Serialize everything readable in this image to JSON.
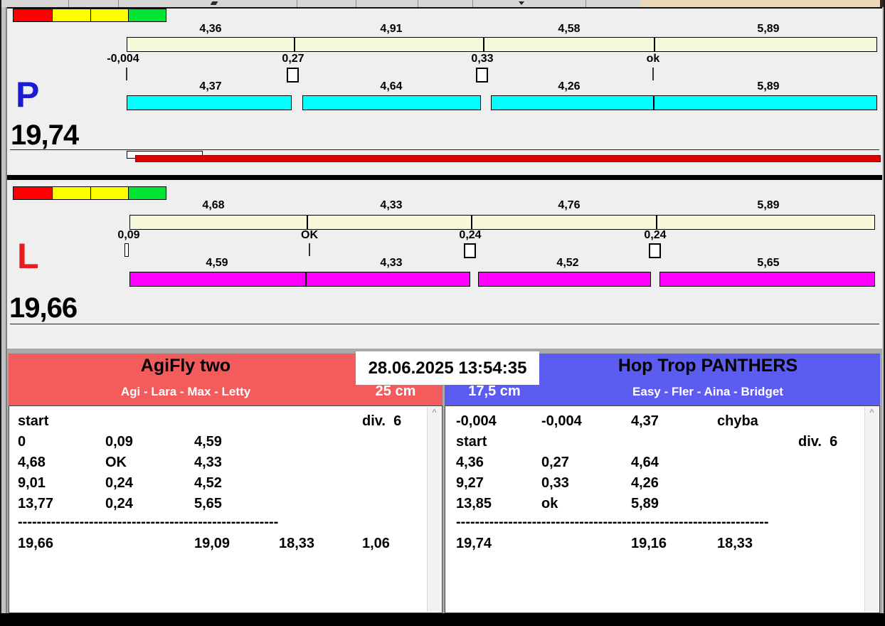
{
  "colors": {
    "strip_cells": [
      "#ff0000",
      "#ffff00",
      "#ffff00",
      "#00e432"
    ],
    "upper_bar": "#f8f8da",
    "lane_p_bar": "#00ffff",
    "lane_l_bar": "#ff00ff",
    "lane_p_letter": "#1b1bd6",
    "lane_l_letter": "#e81c1c",
    "progress_red": "#dd0202",
    "team_left_bg": "#f25c5c",
    "team_right_bg": "#5c5cf0",
    "panel_bg": "#efefef",
    "band_bg": "#a9a9a9"
  },
  "icons": {
    "scroll_up": "^"
  },
  "lane_p": {
    "letter": "P",
    "total": "19,74",
    "upper_segments": [
      "4,36",
      "4,91",
      "4,58",
      "5,89"
    ],
    "markers": [
      "-0,004",
      "0,27",
      "0,33",
      "ok"
    ],
    "lower_segments": [
      "4,37",
      "4,64",
      "4,26",
      "5,89"
    ]
  },
  "lane_l": {
    "letter": "L",
    "total": "19,66",
    "upper_segments": [
      "4,68",
      "4,33",
      "4,76",
      "5,89"
    ],
    "markers": [
      "0,09",
      "OK",
      "0,24",
      "0,24"
    ],
    "lower_segments": [
      "4,59",
      "4,33",
      "4,52",
      "5,65"
    ]
  },
  "scoreboard": {
    "datetime": "28.06.2025 13:54:35",
    "left": {
      "team": "AgiFly two",
      "members": "Agi - Lara - Max - Letty",
      "jump_height": "25 cm",
      "div_label": "div.  6",
      "rows": [
        {
          "c1": "start"
        },
        {
          "c1": "0",
          "c2": "0,09",
          "c3": "4,59"
        },
        {
          "c1": "4,68",
          "c2": "OK",
          "c3": "4,33"
        },
        {
          "c1": "9,01",
          "c2": "0,24",
          "c3": "4,52"
        },
        {
          "c1": "13,77",
          "c2": "0,24",
          "c3": "5,65"
        }
      ],
      "separator": "-------------------------------------------------------",
      "totals": {
        "t1": "19,66",
        "t2": "19,09",
        "t3": "18,33",
        "t4": "1,06"
      }
    },
    "right": {
      "team": "Hop Trop PANTHERS",
      "members": "Easy - Fler - Aina - Bridget",
      "jump_height": "17,5 cm",
      "div_label": "div.  6",
      "pre_row": {
        "c1": "-0,004",
        "c2": "-0,004",
        "c3": "4,37",
        "c4": "chyba"
      },
      "rows": [
        {
          "c1": "start"
        },
        {
          "c1": "4,36",
          "c2": "0,27",
          "c3": "4,64"
        },
        {
          "c1": "9,27",
          "c2": "0,33",
          "c3": "4,26"
        },
        {
          "c1": "13,85",
          "c2": "ok",
          "c3": "5,89"
        }
      ],
      "separator": "------------------------------------------------------------------",
      "totals": {
        "t1": "19,74",
        "t2": "19,16",
        "t3": "18,33"
      }
    }
  }
}
